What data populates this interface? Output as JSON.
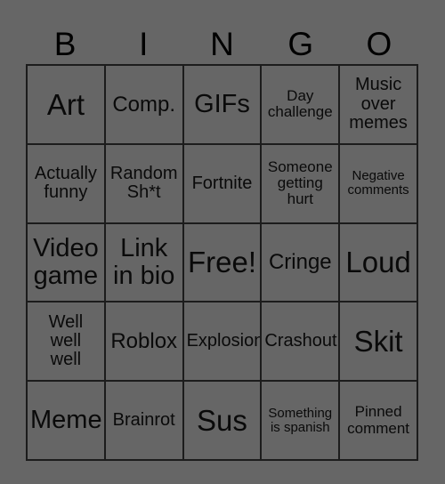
{
  "card": {
    "title": "BINGO",
    "background_color": "#666666",
    "border_color": "#1c1c1c",
    "text_color": "#0a0a0a",
    "columns": 5,
    "rows": 5,
    "header_letters": [
      "B",
      "I",
      "N",
      "G",
      "O"
    ],
    "cells": [
      {
        "text": "Art",
        "size": "fs-xxl"
      },
      {
        "text": "Comp.",
        "size": "fs-l"
      },
      {
        "text": "GIFs",
        "size": "fs-xl"
      },
      {
        "text": "Day\nchallenge",
        "size": "fs-s"
      },
      {
        "text": "Music\nover\nmemes",
        "size": "fs-m"
      },
      {
        "text": "Actually\nfunny",
        "size": "fs-m"
      },
      {
        "text": "Random\nSh*t",
        "size": "fs-m"
      },
      {
        "text": "Fortnite",
        "size": "fs-m"
      },
      {
        "text": "Someone\ngetting\nhurt",
        "size": "fs-s"
      },
      {
        "text": "Negative\ncomments",
        "size": "fs-xs"
      },
      {
        "text": "Video\ngame",
        "size": "fs-xl"
      },
      {
        "text": "Link\nin bio",
        "size": "fs-xl"
      },
      {
        "text": "Free!",
        "size": "fs-xxl"
      },
      {
        "text": "Cringe",
        "size": "fs-l"
      },
      {
        "text": "Loud",
        "size": "fs-xxl"
      },
      {
        "text": "Well\nwell\nwell",
        "size": "fs-m"
      },
      {
        "text": "Roblox",
        "size": "fs-l"
      },
      {
        "text": "Explosion",
        "size": "fs-m"
      },
      {
        "text": "Crashout",
        "size": "fs-m"
      },
      {
        "text": "Skit",
        "size": "fs-xxl"
      },
      {
        "text": "Meme",
        "size": "fs-xl"
      },
      {
        "text": "Brainrot",
        "size": "fs-m"
      },
      {
        "text": "Sus",
        "size": "fs-xxl"
      },
      {
        "text": "Something\nis spanish",
        "size": "fs-xs"
      },
      {
        "text": "Pinned\ncomment",
        "size": "fs-s"
      }
    ]
  }
}
